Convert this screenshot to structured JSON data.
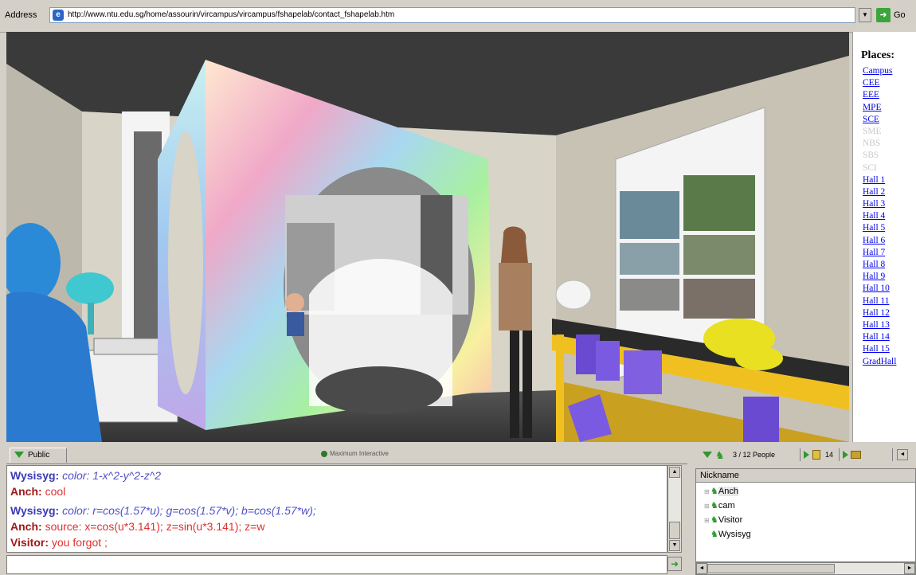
{
  "browser": {
    "address_label": "Address",
    "url": "http://www.ntu.edu.sg/home/assourin/vircampus/vircampus/fshapelab/contact_fshapelab.htm",
    "go_label": "Go"
  },
  "places": {
    "title": "Places:",
    "items": [
      {
        "label": "Campus",
        "enabled": true
      },
      {
        "label": "CEE",
        "enabled": true
      },
      {
        "label": "EEE",
        "enabled": true
      },
      {
        "label": "MPE",
        "enabled": true
      },
      {
        "label": "SCE",
        "enabled": true
      },
      {
        "label": "SME",
        "enabled": false
      },
      {
        "label": "NBS",
        "enabled": false
      },
      {
        "label": "SBS",
        "enabled": false
      },
      {
        "label": "SCI",
        "enabled": false
      },
      {
        "label": "Hall 1",
        "enabled": true
      },
      {
        "label": "Hall 2",
        "enabled": true
      },
      {
        "label": "Hall 3",
        "enabled": true
      },
      {
        "label": "Hall 4",
        "enabled": true
      },
      {
        "label": "Hall 5",
        "enabled": true
      },
      {
        "label": "Hall 6",
        "enabled": true
      },
      {
        "label": "Hall 7",
        "enabled": true
      },
      {
        "label": "Hall 8",
        "enabled": true
      },
      {
        "label": "Hall 9",
        "enabled": true
      },
      {
        "label": "Hall 10",
        "enabled": true
      },
      {
        "label": "Hall 11",
        "enabled": true
      },
      {
        "label": "Hall 12",
        "enabled": true
      },
      {
        "label": "Hall 13",
        "enabled": true
      },
      {
        "label": "Hall 14",
        "enabled": true
      },
      {
        "label": "Hall 15",
        "enabled": true
      },
      {
        "label": "GradHall",
        "enabled": true
      }
    ]
  },
  "chat": {
    "tab_label": "Public",
    "status": "Maximum Interactive",
    "messages": [
      {
        "nick": "Wysisyg:",
        "text": "color: 1-x^2-y^2-z^2",
        "style": "blue"
      },
      {
        "nick": "Anch:",
        "text": "cool",
        "style": "red"
      },
      {
        "nick": "Wysisyg:",
        "text": "color: r=cos(1.57*u); g=cos(1.57*v); b=cos(1.57*w);",
        "style": "blue"
      },
      {
        "nick": "Anch:",
        "text": "source: x=cos(u*3.141); z=sin(u*3.141); z=w",
        "style": "red"
      },
      {
        "nick": "Visitor:",
        "text": "you forgot ;",
        "style": "red"
      }
    ],
    "input_value": ""
  },
  "people": {
    "count_label": "3 / 12 People",
    "objects_count": "14",
    "column_header": "Nickname",
    "list": [
      {
        "name": "Anch",
        "selected": true
      },
      {
        "name": "cam",
        "selected": false
      },
      {
        "name": "Visitor",
        "selected": false
      },
      {
        "name": "Wysisyg",
        "selected": false
      }
    ]
  },
  "icons": {
    "ie": "ie-page-icon",
    "go": "go-arrow-icon",
    "public_tab": "triangle-down-icon",
    "status": "status-dot-icon",
    "people": "people-icon",
    "send": "send-icon"
  },
  "colors": {
    "link": "#0000ee",
    "disabled_link": "#c8c8c8",
    "chat_blue": "#5050c8",
    "chat_red": "#e03030",
    "accent_green": "#2d9a2d"
  }
}
